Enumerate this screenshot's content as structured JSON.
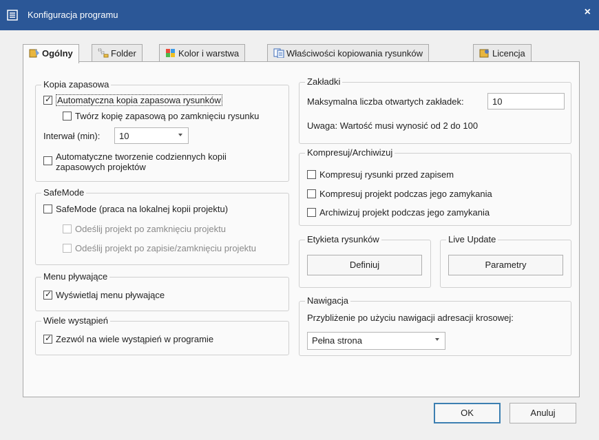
{
  "window": {
    "title": "Konfiguracja programu",
    "close_glyph": "×"
  },
  "tabs": [
    {
      "label": "Ogólny",
      "icon": "general-icon",
      "active": true
    },
    {
      "label": "Folder",
      "icon": "folder-icon",
      "active": false
    },
    {
      "label": "Kolor i warstwa",
      "icon": "color-icon",
      "active": false
    },
    {
      "label": "Właściwości kopiowania rysunków",
      "icon": "copy-properties-icon",
      "active": false
    },
    {
      "label": "Licencja",
      "icon": "license-icon",
      "active": false
    }
  ],
  "backup": {
    "label": "Kopia zapasowa",
    "auto_backup": {
      "label": "Automatyczna kopia zapasowa rysunków",
      "checked": true
    },
    "backup_on_close": {
      "label": "Twórz kopię zapasową po zamknięciu rysunku",
      "checked": false
    },
    "interval_label": "Interwał (min):",
    "interval_value": "10",
    "daily_backup_line1": "Automatyczne tworzenie codziennych kopii",
    "daily_backup_line2": "zapasowych projektów",
    "daily_backup_checked": false
  },
  "safemode": {
    "label": "SafeMode",
    "safemode_check": {
      "label": "SafeMode (praca na lokalnej kopii projektu)",
      "checked": false
    },
    "send_on_close": {
      "label": "Odeślij projekt po zamknięciu projektu",
      "checked": false
    },
    "send_on_save": {
      "label": "Odeślij projekt po zapisie/zamknięciu projektu",
      "checked": false
    }
  },
  "floating_menu": {
    "label": "Menu pływające",
    "show": {
      "label": "Wyświetlaj menu pływające",
      "checked": true
    }
  },
  "instances": {
    "label": "Wiele wystąpień",
    "allow": {
      "label": "Zezwól na wiele wystąpień w programie",
      "checked": true
    }
  },
  "bookmarks": {
    "label": "Zakładki",
    "max_label": "Maksymalna liczba otwartych zakładek:",
    "max_value": "10",
    "note": "Uwaga: Wartość musi wynosić od 2 do 100"
  },
  "compress": {
    "label": "Kompresuj/Archiwizuj",
    "before_save": {
      "label": "Kompresuj rysunki przed zapisem",
      "checked": false
    },
    "on_close": {
      "label": "Kompresuj projekt podczas jego zamykania",
      "checked": false
    },
    "archive_on_close": {
      "label": "Archiwizuj projekt podczas jego zamykania",
      "checked": false
    }
  },
  "drawing_label": {
    "label": "Etykieta rysunków",
    "button": "Definiuj"
  },
  "live_update": {
    "label": "Live Update",
    "button": "Parametry"
  },
  "navigation": {
    "label": "Nawigacja",
    "zoom_label": "Przybliżenie po użyciu nawigacji adresacji krosowej:",
    "zoom_value": "Pełna strona"
  },
  "footer": {
    "ok": "OK",
    "cancel": "Anuluj"
  },
  "colors": {
    "titlebar": "#2b5797",
    "default_button_border": "#3c7fb1"
  }
}
